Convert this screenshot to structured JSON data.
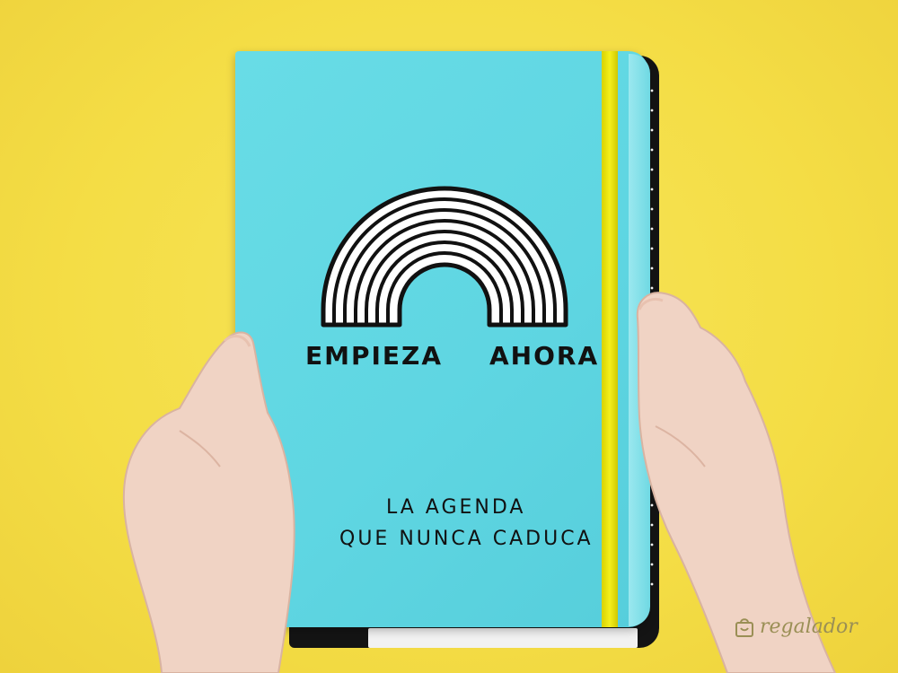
{
  "cover": {
    "line1_left": "EMPIEZA",
    "line1_right": "AHORA",
    "tagline_1": "LA AGENDA",
    "tagline_2": "QUE NUNCA CADUCA"
  },
  "watermark": {
    "text": "regalador",
    "icon": "gift-bag-icon"
  },
  "colors": {
    "background": "#f4dd45",
    "cover": "#5fd6e2",
    "elastic_band": "#f4ef1c",
    "book_back": "#141414",
    "skin": "#f0d3c4"
  }
}
